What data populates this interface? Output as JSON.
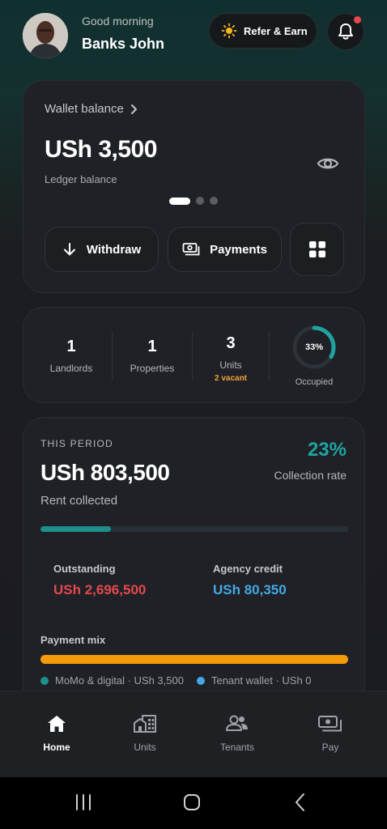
{
  "header": {
    "greeting": "Good morning",
    "user_name": "Banks John",
    "refer_label": "Refer & Earn"
  },
  "wallet": {
    "title": "Wallet balance",
    "amount": "USh 3,500",
    "subtitle": "Ledger balance",
    "withdraw_label": "Withdraw",
    "payments_label": "Payments",
    "page_index": 1,
    "page_count": 3
  },
  "stats": {
    "landlords": {
      "value": "1",
      "label": "Landlords"
    },
    "properties": {
      "value": "1",
      "label": "Properties"
    },
    "units": {
      "value": "3",
      "label": "Units",
      "note": "2 vacant"
    },
    "occupied": {
      "percent_text": "33%",
      "fraction": 0.33,
      "label": "Occupied"
    }
  },
  "period": {
    "label": "THIS PERIOD",
    "amount": "USh 803,500",
    "amount_label": "Rent collected",
    "rate": "23%",
    "rate_label": "Collection rate",
    "progress_fraction": 0.23,
    "outstanding_label": "Outstanding",
    "outstanding_value": "USh 2,696,500",
    "credit_label": "Agency credit",
    "credit_value": "USh 80,350",
    "mix_label": "Payment mix",
    "legend": [
      {
        "label": "MoMo & digital · USh 3,500",
        "color": "#1d8f8c"
      },
      {
        "label": "Tenant wallet · USh 0",
        "color": "#43a8e6"
      }
    ]
  },
  "nav": {
    "items": [
      {
        "label": "Home",
        "icon": "home-icon"
      },
      {
        "label": "Units",
        "icon": "buildings-icon"
      },
      {
        "label": "Tenants",
        "icon": "people-icon"
      },
      {
        "label": "Pay",
        "icon": "cash-icon"
      }
    ]
  },
  "colors": {
    "accent": "#1fa3a0",
    "danger": "#e5484d",
    "info": "#43a8e6",
    "warning": "#f59a0b"
  }
}
